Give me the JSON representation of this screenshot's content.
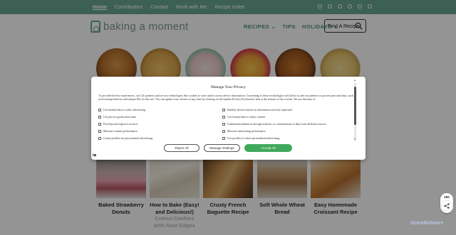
{
  "topnav": {
    "items": [
      {
        "label": "Home",
        "active": true
      },
      {
        "label": "Contributors"
      },
      {
        "label": "Contact"
      },
      {
        "label": "Work with Me"
      },
      {
        "label": "Recipe Index"
      }
    ],
    "social_icons": [
      "facebook-icon",
      "x-icon",
      "instagram-icon",
      "youtube-icon",
      "tiktok-icon",
      "email-icon"
    ]
  },
  "header": {
    "logo_text": "baking a moment",
    "nav": [
      "RECIPES ⌄",
      "TIPS",
      "HOLIDAYS ⌄"
    ],
    "find_button": "Find A Recipe"
  },
  "privacy_modal": {
    "title": "Manage Your Privacy",
    "description": "To provide the best experiences, our 141 partners and we use technologies like cookies to store and/or access device information. Consenting to these technologies will allow us and our partners to process personal data, such as browsing behavior and unique IDs on this site. You can update your choices at any time by clicking on the Update Privacy Preferences link at the bottom of the screens. We use this data to:",
    "purposes_left": [
      "Use limited data to select advertising",
      "Use precise geolocation data",
      "Develop and improve services",
      "Measure content performance",
      "Create profiles for personalised advertising"
    ],
    "purposes_right": [
      "Identify devices based on information actively requested",
      "Use limited data to select content",
      "Understand audiences through statistics or combinations of data from different sources",
      "Measure advertising performance",
      "Use profiles to select personalised advertising"
    ],
    "reject_label": "Reject All",
    "manage_label": "Manage Settings",
    "accept_label": "Accept All",
    "logo": "Ⅰ⊞"
  },
  "cards": [
    {
      "title": "Baked Strawberry Donuts",
      "faded_lines": ""
    },
    {
      "title": "How to Bake (Easy! and Delicious!)",
      "faded_lines": "Cutout Cookies with Neat Edges"
    },
    {
      "title": "Crusty French Baguette Recipe",
      "faded_lines": ""
    },
    {
      "title": "Soft Whole Wheat Bread",
      "faded_lines": ""
    },
    {
      "title": "Easy Homemade Croissant Recipe",
      "faded_lines": ""
    }
  ],
  "share": {
    "count": "182"
  },
  "watermark": "ScamMalware",
  "colors": {
    "brand_green": "#6aa693",
    "accept_green": "#3fa95b"
  }
}
